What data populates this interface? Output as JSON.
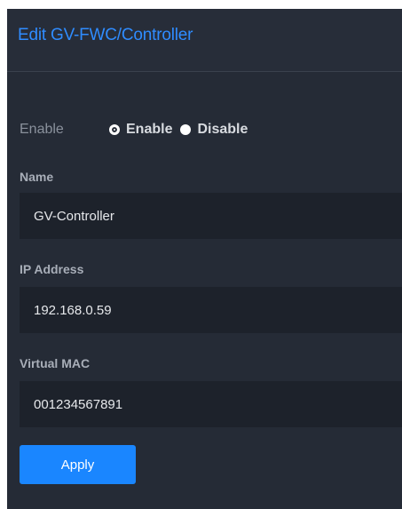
{
  "header": {
    "title": "Edit GV-FWC/Controller"
  },
  "enable": {
    "label": "Enable",
    "options": [
      {
        "label": "Enable",
        "selected": true
      },
      {
        "label": "Disable",
        "selected": false
      }
    ]
  },
  "fields": {
    "name": {
      "label": "Name",
      "value": "GV-Controller"
    },
    "ip": {
      "label": "IP Address",
      "value": "192.168.0.59"
    },
    "mac": {
      "label": "Virtual MAC",
      "value": "001234567891"
    }
  },
  "actions": {
    "apply_label": "Apply"
  },
  "colors": {
    "accent": "#1a86ff",
    "title": "#2f8cff",
    "panel_bg": "#252b36",
    "input_bg": "#1d222b"
  }
}
